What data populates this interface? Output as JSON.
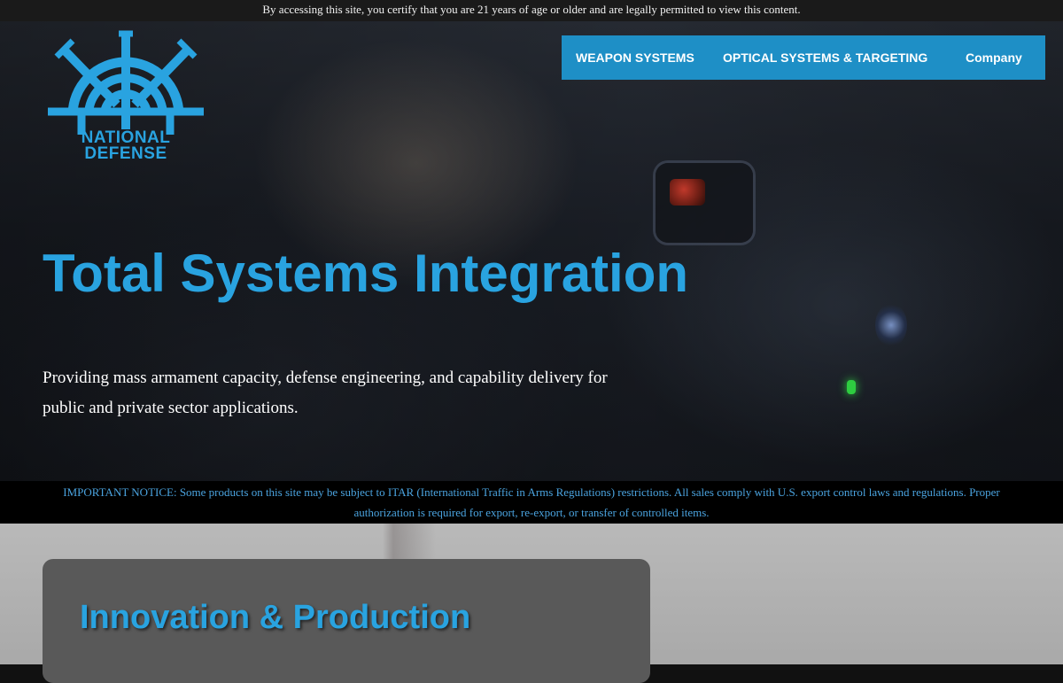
{
  "age_notice": "By accessing this site, you certify that you are 21 years of age or older and are legally permitted to view this content.",
  "brand": {
    "line1": "NATIONAL",
    "line2": "DEFENSE",
    "logo_icon": "ships-wheel-crosshair-icon",
    "color": "#29a3e0"
  },
  "nav": {
    "items": [
      {
        "label": "WEAPON SYSTEMS"
      },
      {
        "label": "OPTICAL SYSTEMS & TARGETING"
      },
      {
        "label": "Company"
      }
    ],
    "background": "#1e8fc6"
  },
  "hero": {
    "title": "Total Systems Integration",
    "subtitle": "Providing mass armament capacity, defense engineering, and capability delivery for public and private sector applications."
  },
  "itar_notice": "IMPORTANT NOTICE: Some products on this site may be subject to ITAR (International Traffic in Arms Regulations) restrictions. All sales comply with U.S. export control laws and regulations. Proper authorization is required for export, re-export, or transfer of controlled items.",
  "section": {
    "title": "Innovation & Production"
  },
  "colors": {
    "accent": "#29a3e0",
    "notice_text": "#4aa3df"
  }
}
